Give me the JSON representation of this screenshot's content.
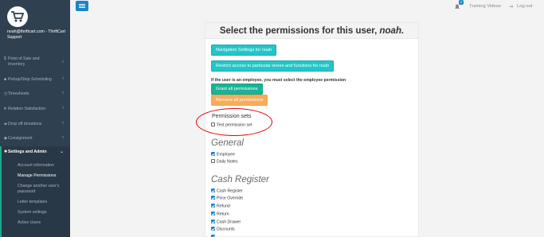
{
  "sidebar": {
    "user_email": "noah@thriftcart.com - ThriftCart Support",
    "items": [
      {
        "label": "Point of Sale and Inventory",
        "icon": "dollar-icon"
      },
      {
        "label": "Pickup/Stop Scheduling",
        "icon": "truck-icon"
      },
      {
        "label": "Timesheets",
        "icon": "clock-icon"
      },
      {
        "label": "Relation Satisfaction",
        "icon": "heart-icon"
      },
      {
        "label": "Drop off donations",
        "icon": "car-icon"
      },
      {
        "label": "Consignment",
        "icon": "tag-icon"
      },
      {
        "label": "Settings and Admin",
        "icon": "gear-icon"
      }
    ],
    "subitems": [
      {
        "label": "Account information"
      },
      {
        "label": "Manage Permissions"
      },
      {
        "label": "Change another user's password"
      },
      {
        "label": "Letter templates"
      },
      {
        "label": "System settings"
      },
      {
        "label": "Active Users"
      }
    ]
  },
  "topbar": {
    "notification_count": "2",
    "training_label": "Training Videos",
    "logout_label": "Log out"
  },
  "panel": {
    "title_prefix": "Select the permissions for this user,",
    "username": "noah.",
    "nav_settings_button": "Navigation Settings for noah",
    "restrict_button": "Restrict access to particular stores and functions for noah",
    "employee_note": "If the user is an employee, you must select the employee permission",
    "grant_button": "Grant all permissions",
    "remove_button": "Remove all permissions",
    "permission_sets_title": "Permission sets",
    "permission_sets": [
      {
        "label": "Test permission set",
        "checked": false
      }
    ],
    "sections": [
      {
        "title": "General",
        "items": [
          {
            "label": "Employee",
            "checked": true
          },
          {
            "label": "Daily Notes",
            "checked": false
          }
        ]
      },
      {
        "title": "Cash Register",
        "items": [
          {
            "label": "Cash Register",
            "checked": true
          },
          {
            "label": "Price Override",
            "checked": true
          },
          {
            "label": "Refund",
            "checked": true
          },
          {
            "label": "Return",
            "checked": true
          },
          {
            "label": "Cash Drawer",
            "checked": true
          },
          {
            "label": "Discounts",
            "checked": true
          }
        ]
      }
    ]
  },
  "colors": {
    "sidebar": "#2f4050",
    "accent": "#1ab394",
    "info": "#23c6c8",
    "warning": "#f8ac59",
    "blue": "#1c84c6",
    "highlight": "#e00000"
  }
}
